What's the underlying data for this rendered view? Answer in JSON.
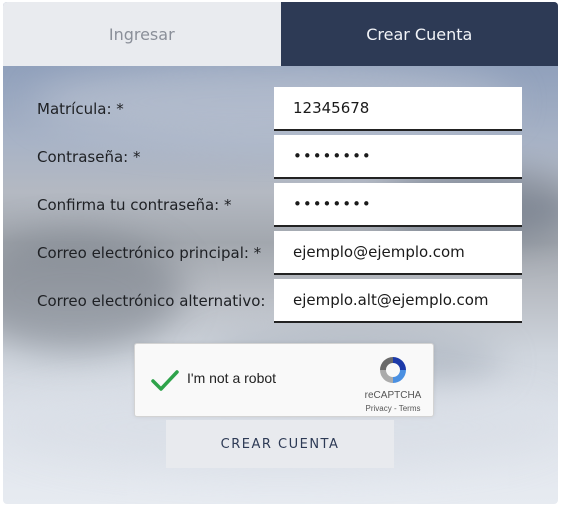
{
  "tabs": {
    "login": "Ingresar",
    "signup": "Crear Cuenta"
  },
  "form": {
    "fields": [
      {
        "label": "Matrícula: *",
        "value": "12345678"
      },
      {
        "label": "Contraseña: *",
        "value": "••••••••"
      },
      {
        "label": "Confirma tu contraseña: *",
        "value": "••••••••"
      },
      {
        "label": "Correo electrónico principal: *",
        "value": "ejemplo@ejemplo.com"
      },
      {
        "label": "Correo electrónico alternativo:",
        "value": "ejemplo.alt@ejemplo.com"
      }
    ]
  },
  "captcha": {
    "label": "I'm not a robot",
    "brand": "reCAPTCHA",
    "privacy": "Privacy",
    "separator": " - ",
    "terms": "Terms",
    "checked": true,
    "check_color": "#2ea34a"
  },
  "submit": {
    "label": "CREAR CUENTA"
  },
  "colors": {
    "tab_active": "#2d3a55",
    "tab_inactive": "#e9ebef"
  }
}
